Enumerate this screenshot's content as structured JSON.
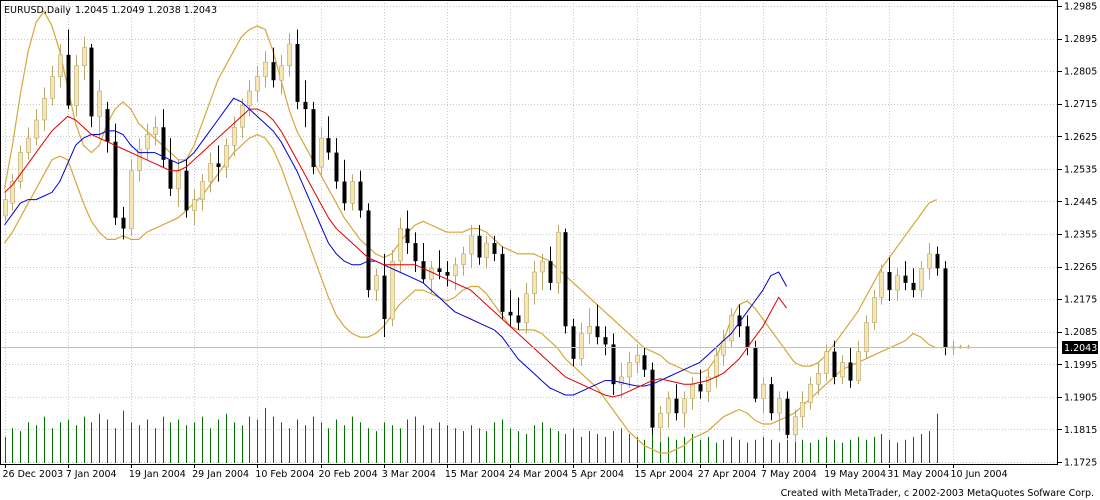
{
  "header": {
    "symbol": "EURUSD,Daily",
    "ohlc": "1.2045 1.2049 1.2038 1.2043"
  },
  "footer": {
    "credit": "Created with MetaTrader, c 2002-2003 MetaQuotes Sofware Corp."
  },
  "colors": {
    "background": "#ffffff",
    "grid": "#c8c8c8",
    "bull_candle": "#f5e6b4",
    "bear_candle": "#000000",
    "wick": "#b9a66a",
    "envelope": "#d4a83a",
    "ma_fast": "#e00000",
    "ma_slow": "#0000d0",
    "volume": "#007000",
    "price_tag": "#000000"
  },
  "chart_data": {
    "type": "candlestick",
    "symbol": "EURUSD",
    "timeframe": "Daily",
    "current_price": "1.2043",
    "ylim": [
      1.1725,
      1.2985
    ],
    "y_ticks": [
      "1.2985",
      "1.2895",
      "1.2805",
      "1.2715",
      "1.2625",
      "1.2535",
      "1.2445",
      "1.2355",
      "1.2265",
      "1.2175",
      "1.2085",
      "1.1995",
      "1.1905",
      "1.1815",
      "1.1725"
    ],
    "x_ticks": [
      {
        "label": "26 Dec 2003",
        "index": 0
      },
      {
        "label": "7 Jan 2004",
        "index": 8
      },
      {
        "label": "19 Jan 2004",
        "index": 16
      },
      {
        "label": "29 Jan 2004",
        "index": 24
      },
      {
        "label": "10 Feb 2004",
        "index": 32
      },
      {
        "label": "20 Feb 2004",
        "index": 40
      },
      {
        "label": "3 Mar 2004",
        "index": 48
      },
      {
        "label": "15 Mar 2004",
        "index": 56
      },
      {
        "label": "24 Mar 2004",
        "index": 64
      },
      {
        "label": "5 Apr 2004",
        "index": 72
      },
      {
        "label": "15 Apr 2004",
        "index": 80
      },
      {
        "label": "27 Apr 2004",
        "index": 88
      },
      {
        "label": "7 May 2004",
        "index": 96
      },
      {
        "label": "19 May 2004",
        "index": 104
      },
      {
        "label": "31 May 2004",
        "index": 112
      },
      {
        "label": "10 Jun 2004",
        "index": 120
      }
    ],
    "candle_count": 119,
    "candles": [
      [
        1.2405,
        1.247,
        1.239,
        1.245
      ],
      [
        1.244,
        1.252,
        1.242,
        1.25
      ],
      [
        1.25,
        1.26,
        1.248,
        1.258
      ],
      [
        1.258,
        1.265,
        1.256,
        1.262
      ],
      [
        1.262,
        1.27,
        1.26,
        1.267
      ],
      [
        1.267,
        1.276,
        1.264,
        1.273
      ],
      [
        1.273,
        1.282,
        1.271,
        1.279
      ],
      [
        1.279,
        1.288,
        1.276,
        1.285
      ],
      [
        1.285,
        1.292,
        1.27,
        1.271
      ],
      [
        1.271,
        1.285,
        1.268,
        1.282
      ],
      [
        1.282,
        1.29,
        1.278,
        1.287
      ],
      [
        1.287,
        1.288,
        1.265,
        1.268
      ],
      [
        1.268,
        1.278,
        1.262,
        1.275
      ],
      [
        1.27,
        1.272,
        1.258,
        1.261
      ],
      [
        1.261,
        1.266,
        1.238,
        1.24
      ],
      [
        1.24,
        1.243,
        1.234,
        1.237
      ],
      [
        1.237,
        1.256,
        1.235,
        1.253
      ],
      [
        1.253,
        1.262,
        1.25,
        1.259
      ],
      [
        1.259,
        1.266,
        1.256,
        1.263
      ],
      [
        1.263,
        1.268,
        1.26,
        1.265
      ],
      [
        1.265,
        1.27,
        1.254,
        1.256
      ],
      [
        1.256,
        1.262,
        1.246,
        1.248
      ],
      [
        1.248,
        1.256,
        1.243,
        1.253
      ],
      [
        1.253,
        1.256,
        1.24,
        1.242
      ],
      [
        1.242,
        1.248,
        1.238,
        1.245
      ],
      [
        1.245,
        1.252,
        1.242,
        1.25
      ],
      [
        1.25,
        1.258,
        1.247,
        1.255
      ],
      [
        1.255,
        1.26,
        1.25,
        1.254
      ],
      [
        1.254,
        1.262,
        1.251,
        1.26
      ],
      [
        1.26,
        1.268,
        1.257,
        1.265
      ],
      [
        1.265,
        1.273,
        1.262,
        1.271
      ],
      [
        1.271,
        1.278,
        1.268,
        1.275
      ],
      [
        1.275,
        1.282,
        1.272,
        1.279
      ],
      [
        1.279,
        1.286,
        1.276,
        1.283
      ],
      [
        1.283,
        1.287,
        1.276,
        1.278
      ],
      [
        1.278,
        1.285,
        1.274,
        1.282
      ],
      [
        1.282,
        1.291,
        1.279,
        1.288
      ],
      [
        1.288,
        1.292,
        1.27,
        1.272
      ],
      [
        1.272,
        1.278,
        1.265,
        1.27
      ],
      [
        1.27,
        1.272,
        1.252,
        1.254
      ],
      [
        1.254,
        1.265,
        1.252,
        1.262
      ],
      [
        1.262,
        1.268,
        1.256,
        1.258
      ],
      [
        1.258,
        1.262,
        1.248,
        1.25
      ],
      [
        1.25,
        1.256,
        1.242,
        1.244
      ],
      [
        1.244,
        1.252,
        1.242,
        1.25
      ],
      [
        1.25,
        1.253,
        1.24,
        1.242
      ],
      [
        1.242,
        1.244,
        1.218,
        1.22
      ],
      [
        1.22,
        1.226,
        1.217,
        1.224
      ],
      [
        1.224,
        1.23,
        1.207,
        1.212
      ],
      [
        1.212,
        1.231,
        1.21,
        1.228
      ],
      [
        1.228,
        1.24,
        1.225,
        1.237
      ],
      [
        1.237,
        1.242,
        1.23,
        1.233
      ],
      [
        1.233,
        1.236,
        1.225,
        1.228
      ],
      [
        1.228,
        1.233,
        1.222,
        1.223
      ],
      [
        1.223,
        1.228,
        1.219,
        1.226
      ],
      [
        1.226,
        1.231,
        1.223,
        1.225
      ],
      [
        1.225,
        1.228,
        1.221,
        1.224
      ],
      [
        1.224,
        1.229,
        1.22,
        1.227
      ],
      [
        1.227,
        1.232,
        1.224,
        1.23
      ],
      [
        1.23,
        1.238,
        1.226,
        1.235
      ],
      [
        1.235,
        1.238,
        1.227,
        1.229
      ],
      [
        1.229,
        1.235,
        1.226,
        1.233
      ],
      [
        1.233,
        1.235,
        1.228,
        1.23
      ],
      [
        1.23,
        1.232,
        1.212,
        1.214
      ],
      [
        1.214,
        1.22,
        1.21,
        1.213
      ],
      [
        1.213,
        1.218,
        1.209,
        1.211
      ],
      [
        1.211,
        1.222,
        1.208,
        1.219
      ],
      [
        1.219,
        1.228,
        1.216,
        1.225
      ],
      [
        1.225,
        1.23,
        1.22,
        1.228
      ],
      [
        1.228,
        1.232,
        1.22,
        1.222
      ],
      [
        1.222,
        1.238,
        1.219,
        1.236
      ],
      [
        1.236,
        1.237,
        1.208,
        1.21
      ],
      [
        1.21,
        1.212,
        1.199,
        1.201
      ],
      [
        1.201,
        1.211,
        1.199,
        1.208
      ],
      [
        1.208,
        1.215,
        1.205,
        1.21
      ],
      [
        1.21,
        1.216,
        1.205,
        1.207
      ],
      [
        1.207,
        1.21,
        1.202,
        1.205
      ],
      [
        1.205,
        1.208,
        1.191,
        1.194
      ],
      [
        1.194,
        1.2,
        1.19,
        1.196
      ],
      [
        1.196,
        1.203,
        1.193,
        1.2
      ],
      [
        1.2,
        1.205,
        1.197,
        1.202
      ],
      [
        1.202,
        1.204,
        1.196,
        1.198
      ],
      [
        1.198,
        1.2,
        1.18,
        1.182
      ],
      [
        1.182,
        1.188,
        1.178,
        1.186
      ],
      [
        1.186,
        1.192,
        1.182,
        1.19
      ],
      [
        1.19,
        1.194,
        1.184,
        1.186
      ],
      [
        1.186,
        1.192,
        1.182,
        1.19
      ],
      [
        1.19,
        1.196,
        1.187,
        1.194
      ],
      [
        1.194,
        1.198,
        1.19,
        1.192
      ],
      [
        1.192,
        1.198,
        1.189,
        1.196
      ],
      [
        1.196,
        1.204,
        1.193,
        1.202
      ],
      [
        1.202,
        1.209,
        1.199,
        1.206
      ],
      [
        1.206,
        1.215,
        1.204,
        1.213
      ],
      [
        1.213,
        1.216,
        1.207,
        1.21
      ],
      [
        1.21,
        1.213,
        1.202,
        1.204
      ],
      [
        1.204,
        1.206,
        1.189,
        1.19
      ],
      [
        1.19,
        1.196,
        1.186,
        1.194
      ],
      [
        1.194,
        1.196,
        1.184,
        1.186
      ],
      [
        1.186,
        1.192,
        1.181,
        1.19
      ],
      [
        1.19,
        1.192,
        1.179,
        1.18
      ],
      [
        1.18,
        1.187,
        1.178,
        1.185
      ],
      [
        1.185,
        1.192,
        1.182,
        1.189
      ],
      [
        1.189,
        1.196,
        1.187,
        1.194
      ],
      [
        1.194,
        1.2,
        1.191,
        1.197
      ],
      [
        1.197,
        1.205,
        1.195,
        1.203
      ],
      [
        1.203,
        1.206,
        1.194,
        1.196
      ],
      [
        1.196,
        1.202,
        1.194,
        1.2
      ],
      [
        1.2,
        1.204,
        1.193,
        1.195
      ],
      [
        1.195,
        1.206,
        1.194,
        1.203
      ],
      [
        1.203,
        1.213,
        1.201,
        1.211
      ],
      [
        1.211,
        1.22,
        1.209,
        1.218
      ],
      [
        1.218,
        1.227,
        1.216,
        1.225
      ],
      [
        1.225,
        1.229,
        1.217,
        1.22
      ],
      [
        1.22,
        1.226,
        1.217,
        1.224
      ],
      [
        1.224,
        1.228,
        1.22,
        1.222
      ],
      [
        1.222,
        1.226,
        1.218,
        1.22
      ],
      [
        1.22,
        1.228,
        1.218,
        1.226
      ],
      [
        1.226,
        1.233,
        1.223,
        1.23
      ],
      [
        1.23,
        1.232,
        1.224,
        1.226
      ],
      [
        1.226,
        1.228,
        1.202,
        1.204
      ],
      [
        1.204,
        1.206,
        1.202,
        1.2043
      ],
      [
        1.2043,
        1.2049,
        1.2038,
        1.2043
      ],
      [
        1.2043,
        1.2049,
        1.2038,
        1.2043
      ]
    ],
    "envelope_upper": [
      1.248,
      1.26,
      1.274,
      1.286,
      1.294,
      1.297,
      1.293,
      1.286,
      1.276,
      1.266,
      1.26,
      1.258,
      1.26,
      1.266,
      1.27,
      1.272,
      1.27,
      1.266,
      1.264,
      1.262,
      1.26,
      1.258,
      1.256,
      1.256,
      1.26,
      1.266,
      1.272,
      1.278,
      1.282,
      1.286,
      1.29,
      1.292,
      1.293,
      1.292,
      1.286,
      1.278,
      1.27,
      1.264,
      1.26,
      1.256,
      1.252,
      1.248,
      1.244,
      1.24,
      1.237,
      1.234,
      1.232,
      1.23,
      1.229,
      1.23,
      1.233,
      1.236,
      1.238,
      1.239,
      1.238,
      1.237,
      1.236,
      1.236,
      1.236,
      1.237,
      1.237,
      1.236,
      1.234,
      1.232,
      1.231,
      1.23,
      1.23,
      1.23,
      1.229,
      1.228,
      1.226,
      1.224,
      1.222,
      1.22,
      1.218,
      1.216,
      1.214,
      1.212,
      1.21,
      1.208,
      1.206,
      1.204,
      1.203,
      1.202,
      1.2,
      1.199,
      1.198,
      1.197,
      1.197,
      1.198,
      1.201,
      1.206,
      1.212,
      1.216,
      1.217,
      1.215,
      1.212,
      1.209,
      1.206,
      1.203,
      1.2,
      1.199,
      1.199,
      1.2,
      1.202,
      1.205,
      1.208,
      1.211,
      1.214,
      1.218,
      1.222,
      1.226,
      1.229,
      1.232,
      1.235,
      1.238,
      1.241,
      1.244,
      1.245
    ],
    "envelope_lower": [
      1.233,
      1.236,
      1.24,
      1.244,
      1.248,
      1.252,
      1.256,
      1.257,
      1.256,
      1.25,
      1.244,
      1.239,
      1.236,
      1.234,
      1.234,
      1.235,
      1.234,
      1.234,
      1.236,
      1.237,
      1.238,
      1.239,
      1.24,
      1.242,
      1.244,
      1.246,
      1.249,
      1.252,
      1.255,
      1.258,
      1.26,
      1.262,
      1.263,
      1.262,
      1.259,
      1.254,
      1.248,
      1.242,
      1.236,
      1.23,
      1.224,
      1.218,
      1.213,
      1.21,
      1.208,
      1.207,
      1.207,
      1.208,
      1.21,
      1.213,
      1.216,
      1.218,
      1.22,
      1.22,
      1.219,
      1.218,
      1.217,
      1.218,
      1.22,
      1.221,
      1.221,
      1.219,
      1.216,
      1.213,
      1.21,
      1.209,
      1.209,
      1.209,
      1.208,
      1.206,
      1.204,
      1.201,
      1.199,
      1.197,
      1.195,
      1.193,
      1.19,
      1.187,
      1.184,
      1.181,
      1.179,
      1.177,
      1.176,
      1.175,
      1.175,
      1.176,
      1.177,
      1.179,
      1.18,
      1.181,
      1.183,
      1.185,
      1.186,
      1.187,
      1.186,
      1.184,
      1.183,
      1.183,
      1.184,
      1.185,
      1.186,
      1.188,
      1.19,
      1.192,
      1.194,
      1.196,
      1.198,
      1.199,
      1.2,
      1.201,
      1.202,
      1.203,
      1.204,
      1.205,
      1.206,
      1.208,
      1.207,
      1.205,
      1.204
    ],
    "ma_fast": [
      1.247,
      1.249,
      1.252,
      1.255,
      1.258,
      1.261,
      1.264,
      1.266,
      1.268,
      1.267,
      1.265,
      1.263,
      1.262,
      1.261,
      1.26,
      1.259,
      1.258,
      1.257,
      1.256,
      1.255,
      1.254,
      1.253,
      1.253,
      1.254,
      1.256,
      1.258,
      1.26,
      1.262,
      1.264,
      1.266,
      1.268,
      1.27,
      1.27,
      1.269,
      1.267,
      1.264,
      1.26,
      1.256,
      1.252,
      1.248,
      1.244,
      1.24,
      1.237,
      1.235,
      1.233,
      1.231,
      1.229,
      1.228,
      1.227,
      1.227,
      1.227,
      1.227,
      1.227,
      1.226,
      1.225,
      1.224,
      1.223,
      1.222,
      1.221,
      1.22,
      1.218,
      1.216,
      1.214,
      1.212,
      1.21,
      1.208,
      1.206,
      1.204,
      1.202,
      1.2,
      1.198,
      1.196,
      1.195,
      1.194,
      1.193,
      1.192,
      1.191,
      1.1905,
      1.191,
      1.192,
      1.193,
      1.194,
      1.195,
      1.1955,
      1.195,
      1.1945,
      1.194,
      1.194,
      1.1945,
      1.195,
      1.196,
      1.197,
      1.199,
      1.201,
      1.204,
      1.207,
      1.21,
      1.214,
      1.218,
      1.215
    ],
    "ma_slow": [
      1.238,
      1.241,
      1.244,
      1.245,
      1.245,
      1.246,
      1.247,
      1.25,
      1.255,
      1.26,
      1.262,
      1.263,
      1.263,
      1.264,
      1.264,
      1.263,
      1.26,
      1.258,
      1.258,
      1.258,
      1.257,
      1.256,
      1.255,
      1.256,
      1.258,
      1.261,
      1.264,
      1.267,
      1.27,
      1.273,
      1.272,
      1.27,
      1.268,
      1.266,
      1.264,
      1.261,
      1.257,
      1.253,
      1.248,
      1.243,
      1.238,
      1.233,
      1.23,
      1.228,
      1.227,
      1.227,
      1.228,
      1.228,
      1.227,
      1.226,
      1.225,
      1.224,
      1.223,
      1.222,
      1.22,
      1.218,
      1.216,
      1.214,
      1.213,
      1.212,
      1.211,
      1.21,
      1.209,
      1.207,
      1.204,
      1.201,
      1.199,
      1.197,
      1.195,
      1.193,
      1.192,
      1.191,
      1.191,
      1.192,
      1.193,
      1.194,
      1.195,
      1.195,
      1.1945,
      1.194,
      1.1935,
      1.1935,
      1.194,
      1.195,
      1.196,
      1.197,
      1.198,
      1.199,
      1.2,
      1.202,
      1.204,
      1.206,
      1.208,
      1.211,
      1.214,
      1.217,
      1.22,
      1.224,
      1.225,
      1.221
    ],
    "volume": [
      0.45,
      0.6,
      0.55,
      0.7,
      0.65,
      0.8,
      0.6,
      0.7,
      0.75,
      0.65,
      0.8,
      0.7,
      0.85,
      0.75,
      0.6,
      0.9,
      0.7,
      0.65,
      0.75,
      0.6,
      0.8,
      0.7,
      0.75,
      0.65,
      0.7,
      0.8,
      0.6,
      0.75,
      0.85,
      0.7,
      0.65,
      0.8,
      0.75,
      0.95,
      0.8,
      0.7,
      0.6,
      0.75,
      0.65,
      0.8,
      0.7,
      0.6,
      0.75,
      0.65,
      0.8,
      0.7,
      0.6,
      0.55,
      0.7,
      0.65,
      0.6,
      0.75,
      0.8,
      0.65,
      0.6,
      0.7,
      0.65,
      0.6,
      0.55,
      0.65,
      0.6,
      0.55,
      0.7,
      0.75,
      0.6,
      0.55,
      0.5,
      0.65,
      0.7,
      0.6,
      0.55,
      0.5,
      0.6,
      0.45,
      0.55,
      0.5,
      0.45,
      0.55,
      0.6,
      0.5,
      0.45,
      0.4,
      0.5,
      0.55,
      0.45,
      0.4,
      0.45,
      0.5,
      0.4,
      0.45,
      0.35,
      0.4,
      0.45,
      0.4,
      0.35,
      0.4,
      0.45,
      0.4,
      0.35,
      0.4,
      0.45,
      0.4,
      0.35,
      0.4,
      0.45,
      0.4,
      0.35,
      0.4,
      0.45,
      0.4,
      0.45,
      0.5,
      0.4,
      0.35,
      0.4,
      0.45,
      0.5,
      0.55,
      0.85
    ]
  }
}
